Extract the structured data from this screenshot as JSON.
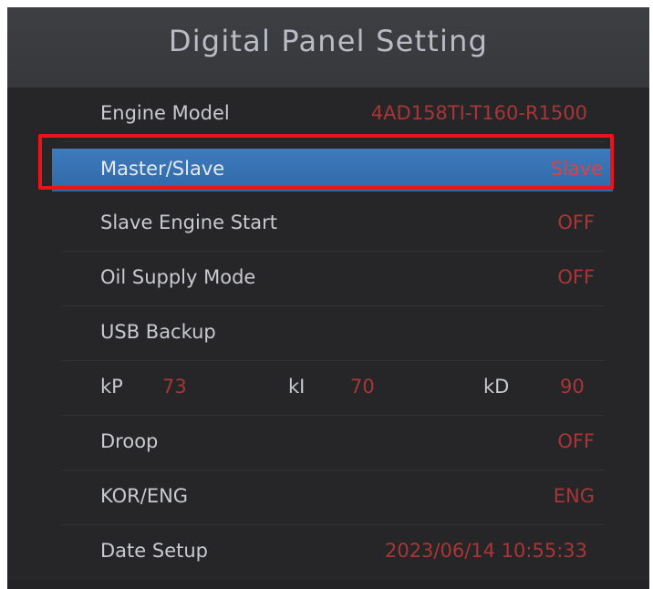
{
  "header": {
    "title": "Digital Panel Setting"
  },
  "rows": [
    {
      "label": "Engine Model",
      "value": "4AD158TI-T160-R1500"
    },
    {
      "label": "Master/Slave",
      "value": "Slave",
      "selected": true
    },
    {
      "label": "Slave Engine Start",
      "value": "OFF"
    },
    {
      "label": "Oil Supply Mode",
      "value": "OFF"
    },
    {
      "label": "USB Backup",
      "value": ""
    },
    {
      "label": "Droop",
      "value": "OFF"
    },
    {
      "label": "KOR/ENG",
      "value": "ENG"
    },
    {
      "label": "Date Setup",
      "value": "2023/06/14 10:55:33"
    }
  ],
  "pid": {
    "kp_label": "kP",
    "kp_value": "73",
    "ki_label": "kI",
    "ki_value": "70",
    "kd_label": "kD",
    "kd_value": "90"
  },
  "colors": {
    "value_text": "#a83636",
    "selected_bg": "#3e7bbd",
    "highlight_border": "#e8141a"
  }
}
